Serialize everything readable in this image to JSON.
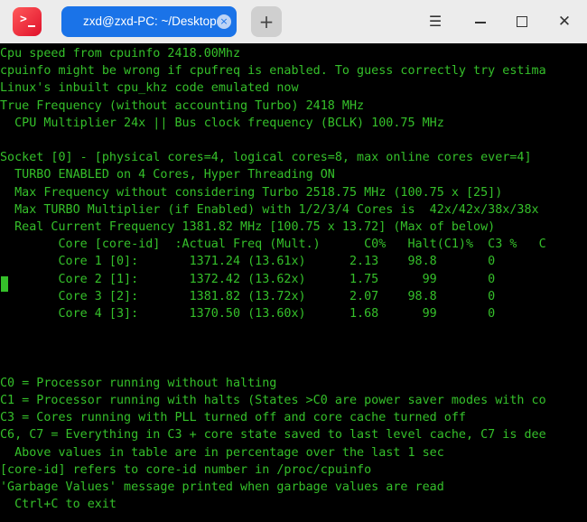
{
  "titlebar": {
    "app_icon": "terminal-icon",
    "tab_title": "zxd@zxd-PC: ~/Desktop",
    "tab_close_glyph": "×",
    "new_tab_glyph": "+",
    "menu_glyph": "☰",
    "close_glyph": "✕"
  },
  "colors": {
    "terminal_bg": "#000000",
    "terminal_text": "#35c02a",
    "tab_active": "#1a73e8",
    "titlebar_bg": "#ececec"
  },
  "terminal": {
    "lines": [
      "Cpu speed from cpuinfo 2418.00Mhz",
      "cpuinfo might be wrong if cpufreq is enabled. To guess correctly try estima",
      "Linux's inbuilt cpu_khz code emulated now",
      "True Frequency (without accounting Turbo) 2418 MHz",
      "  CPU Multiplier 24x || Bus clock frequency (BCLK) 100.75 MHz",
      "",
      "Socket [0] - [physical cores=4, logical cores=8, max online cores ever=4]",
      "  TURBO ENABLED on 4 Cores, Hyper Threading ON",
      "  Max Frequency without considering Turbo 2518.75 MHz (100.75 x [25])",
      "  Max TURBO Multiplier (if Enabled) with 1/2/3/4 Cores is  42x/42x/38x/38x",
      "  Real Current Frequency 1381.82 MHz [100.75 x 13.72] (Max of below)",
      "        Core [core-id]  :Actual Freq (Mult.)      C0%   Halt(C1)%  C3 %   C",
      "        Core 1 [0]:       1371.24 (13.61x)      2.13    98.8       0",
      "        Core 2 [1]:       1372.42 (13.62x)      1.75      99       0",
      "        Core 3 [2]:       1381.82 (13.72x)      2.07    98.8       0",
      "        Core 4 [3]:       1370.50 (13.60x)      1.68      99       0",
      "",
      "",
      "",
      "C0 = Processor running without halting",
      "C1 = Processor running with halts (States >C0 are power saver modes with co",
      "C3 = Cores running with PLL turned off and core cache turned off",
      "C6, C7 = Everything in C3 + core state saved to last level cache, C7 is dee",
      "  Above values in table are in percentage over the last 1 sec",
      "[core-id] refers to core-id number in /proc/cpuinfo",
      "'Garbage Values' message printed when garbage values are read",
      "  Ctrl+C to exit"
    ]
  }
}
